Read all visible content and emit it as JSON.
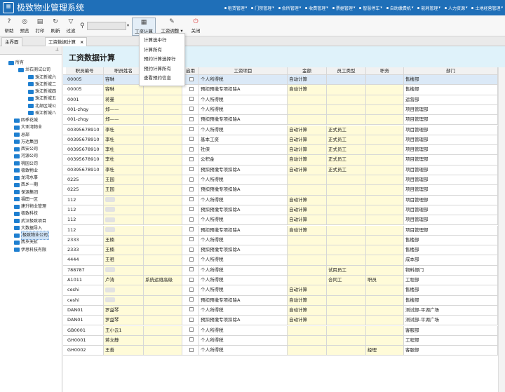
{
  "app": {
    "logo": "≡",
    "title": "极致物业管理系统"
  },
  "topmenu": [
    "租赁管理",
    "门禁管理",
    "会所管理",
    "收费管理",
    "票据管理",
    "智慧停车",
    "自助缴费机",
    "能耗管理",
    "人力资源",
    "土地经营管理"
  ],
  "toolbar": {
    "help": "帮助",
    "preview": "预览",
    "print": "打印",
    "refresh": "刷新",
    "filter": "过滤",
    "search_value": "",
    "salary_calc": "工资计算",
    "salary_adjust": "工资调整",
    "close": "关闭"
  },
  "dropdown": [
    "计算选中行",
    "计算所有",
    "预约计算选择行",
    "预约计算所有",
    "查看预约信息"
  ],
  "tabs": [
    {
      "label": "主界面"
    },
    {
      "label": "工资数据计算"
    }
  ],
  "sidebar": {
    "items": [
      "所有",
      "兰石测试公司",
      "珠江新城六",
      "珠江新城二",
      "珠江新城四",
      "珠江新城五",
      "北部区域公",
      "珠江新城八",
      "四季花城",
      "大亚湾物业",
      "总部",
      "万达集团",
      "西安公司",
      "河源公司",
      "桃园公司",
      "极致物业",
      "龙湾水事",
      "西乡一期",
      "保源集团",
      "福田一区",
      "建升物业管理",
      "极致科技",
      "武汉极致项目",
      "大数据导入",
      "极致物业公司",
      "西乡天虹",
      "伊思科技有限"
    ]
  },
  "page": {
    "title": "工资数据计算"
  },
  "grid": {
    "headers": [
      "职员编号",
      "职员姓名",
      "",
      "启用",
      "工资项目",
      "金额",
      "员工类型",
      "职务",
      "部门"
    ],
    "rows": [
      [
        "00005",
        "容琳",
        "",
        "",
        "个人所得税",
        "自动计算",
        "",
        "",
        "售楼部"
      ],
      [
        "00005",
        "容琳",
        "",
        "",
        "预扣预缴专项扣除A",
        "自动计算",
        "",
        "",
        "售楼部"
      ],
      [
        "0001",
        "蒋曼",
        "",
        "",
        "个人所得税",
        "",
        "",
        "",
        "运营部"
      ],
      [
        "001-zhqy",
        "郑——",
        "",
        "",
        "个人所得税",
        "",
        "",
        "",
        "项目管理部"
      ],
      [
        "001-zhqy",
        "郑——",
        "",
        "",
        "预扣预缴专项扣除A",
        "",
        "",
        "",
        "项目管理部"
      ],
      [
        "00395678910",
        "李杜",
        "",
        "",
        "个人所得税",
        "自动计算",
        "正式员工",
        "",
        "项目管理部"
      ],
      [
        "00395678910",
        "李杜",
        "",
        "",
        "基本工资",
        "自动计算",
        "正式员工",
        "",
        "项目管理部"
      ],
      [
        "00395678910",
        "李杜",
        "",
        "",
        "社保",
        "自动计算",
        "正式员工",
        "",
        "项目管理部"
      ],
      [
        "00395678910",
        "李杜",
        "",
        "",
        "公积金",
        "自动计算",
        "正式员工",
        "",
        "项目管理部"
      ],
      [
        "00395678910",
        "李杜",
        "",
        "",
        "预扣预缴专项扣除A",
        "自动计算",
        "正式员工",
        "",
        "项目管理部"
      ],
      [
        "0225",
        "王园",
        "",
        "",
        "个人所得税",
        "",
        "",
        "",
        "项目管理部"
      ],
      [
        "0225",
        "王园",
        "",
        "",
        "预扣预缴专项扣除A",
        "",
        "",
        "",
        "项目管理部"
      ],
      [
        "112",
        "",
        "",
        "",
        "个人所得税",
        "自动计算",
        "",
        "",
        "项目管理部"
      ],
      [
        "112",
        "",
        "",
        "",
        "预扣预缴专项扣除A",
        "自动计算",
        "",
        "",
        "项目管理部"
      ],
      [
        "112",
        "",
        "",
        "",
        "个人所得税",
        "自动计算",
        "",
        "",
        "项目管理部"
      ],
      [
        "112",
        "",
        "",
        "",
        "预扣预缴专项扣除A",
        "自动计算",
        "",
        "",
        "项目管理部"
      ],
      [
        "2333",
        "王楠",
        "",
        "",
        "个人所得税",
        "",
        "",
        "",
        "售楼部"
      ],
      [
        "2333",
        "王楠",
        "",
        "",
        "预扣预缴专项扣除A",
        "",
        "",
        "",
        "售楼部"
      ],
      [
        "4444",
        "王祖",
        "",
        "",
        "个人所得税",
        "",
        "",
        "",
        "成本部"
      ],
      [
        "788787",
        "",
        "",
        "",
        "个人所得税",
        "",
        "试用员工",
        "",
        "物料部门"
      ],
      [
        "A1011",
        "卢涛",
        "系统运维高级",
        "",
        "个人所得税",
        "",
        "合同工",
        "职员",
        "工程部"
      ],
      [
        "ceshi",
        "",
        "",
        "",
        "个人所得税",
        "自动计算",
        "",
        "",
        "售楼部"
      ],
      [
        "ceshi",
        "",
        "",
        "",
        "预扣预缴专项扣除A",
        "自动计算",
        "",
        "",
        "售楼部"
      ],
      [
        "DAN01",
        "罗益琴",
        "",
        "",
        "个人所得税",
        "自动计算",
        "",
        "",
        "测试部-平湖广场"
      ],
      [
        "DAN01",
        "罗益琴",
        "",
        "",
        "预扣预缴专项扣除A",
        "自动计算",
        "",
        "",
        "测试部-平湖广场"
      ],
      [
        "GB0001",
        "王小云1",
        "",
        "",
        "个人所得税",
        "",
        "",
        "",
        "客服部"
      ],
      [
        "GH0001",
        "蒋文静",
        "",
        "",
        "个人所得税",
        "",
        "",
        "",
        "工程部"
      ],
      [
        "GH0002",
        "王善",
        "",
        "",
        "个人所得税",
        "",
        "",
        "经理",
        "客服部"
      ]
    ]
  },
  "colors": {
    "titlebar": "#1f6fb8",
    "heading_bg": "#dff2fa",
    "cell_yellow": "#fffbd8",
    "selected_row": "#dbe9f7",
    "folder": "#1e7fd0"
  }
}
